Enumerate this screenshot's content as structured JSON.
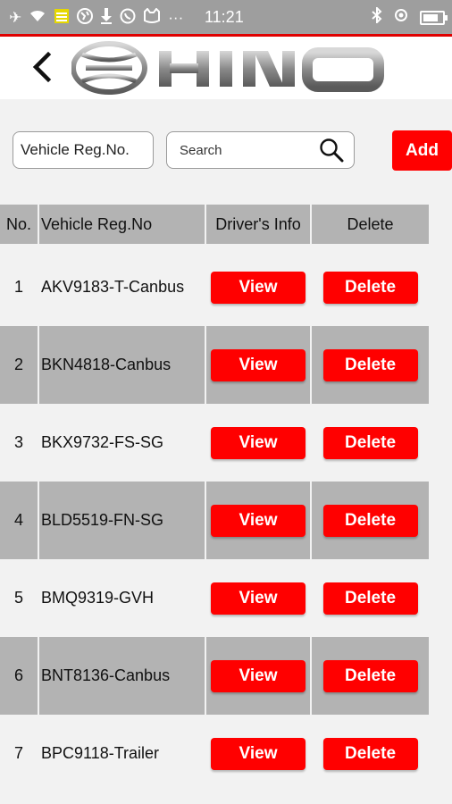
{
  "status_bar": {
    "time": "11:21",
    "icons_left": [
      "airplane-icon",
      "wifi-icon",
      "notes-icon",
      "globe-icon",
      "download-icon",
      "whatsapp-icon",
      "cat-icon",
      "more-icon"
    ],
    "icons_right": [
      "bluetooth-icon",
      "target-icon",
      "battery-icon"
    ],
    "more_dots": "···"
  },
  "header": {
    "back_glyph": "<",
    "brand": "HINO"
  },
  "filter": {
    "reg_select_value": "Vehicle Reg.No.",
    "search_placeholder": "Search",
    "add_label": "Add"
  },
  "table": {
    "headers": {
      "no": "No.",
      "reg": "Vehicle Reg.No",
      "driver": "Driver's Info",
      "delete": "Delete"
    },
    "rows": [
      {
        "no": "1",
        "reg": "AKV9183-T-Canbus",
        "view": "View",
        "delete": "Delete"
      },
      {
        "no": "2",
        "reg": "BKN4818-Canbus",
        "view": "View",
        "delete": "Delete"
      },
      {
        "no": "3",
        "reg": "BKX9732-FS-SG",
        "view": "View",
        "delete": "Delete"
      },
      {
        "no": "4",
        "reg": "BLD5519-FN-SG",
        "view": "View",
        "delete": "Delete"
      },
      {
        "no": "5",
        "reg": "BMQ9319-GVH",
        "view": "View",
        "delete": "Delete"
      },
      {
        "no": "6",
        "reg": "BNT8136-Canbus",
        "view": "View",
        "delete": "Delete"
      },
      {
        "no": "7",
        "reg": "BPC9118-Trailer",
        "view": "View",
        "delete": "Delete"
      }
    ]
  },
  "colors": {
    "accent": "#ff0000",
    "header_gray": "#b3b3b3",
    "status_gray": "#9e9e9e",
    "background": "#f2f2f2"
  }
}
